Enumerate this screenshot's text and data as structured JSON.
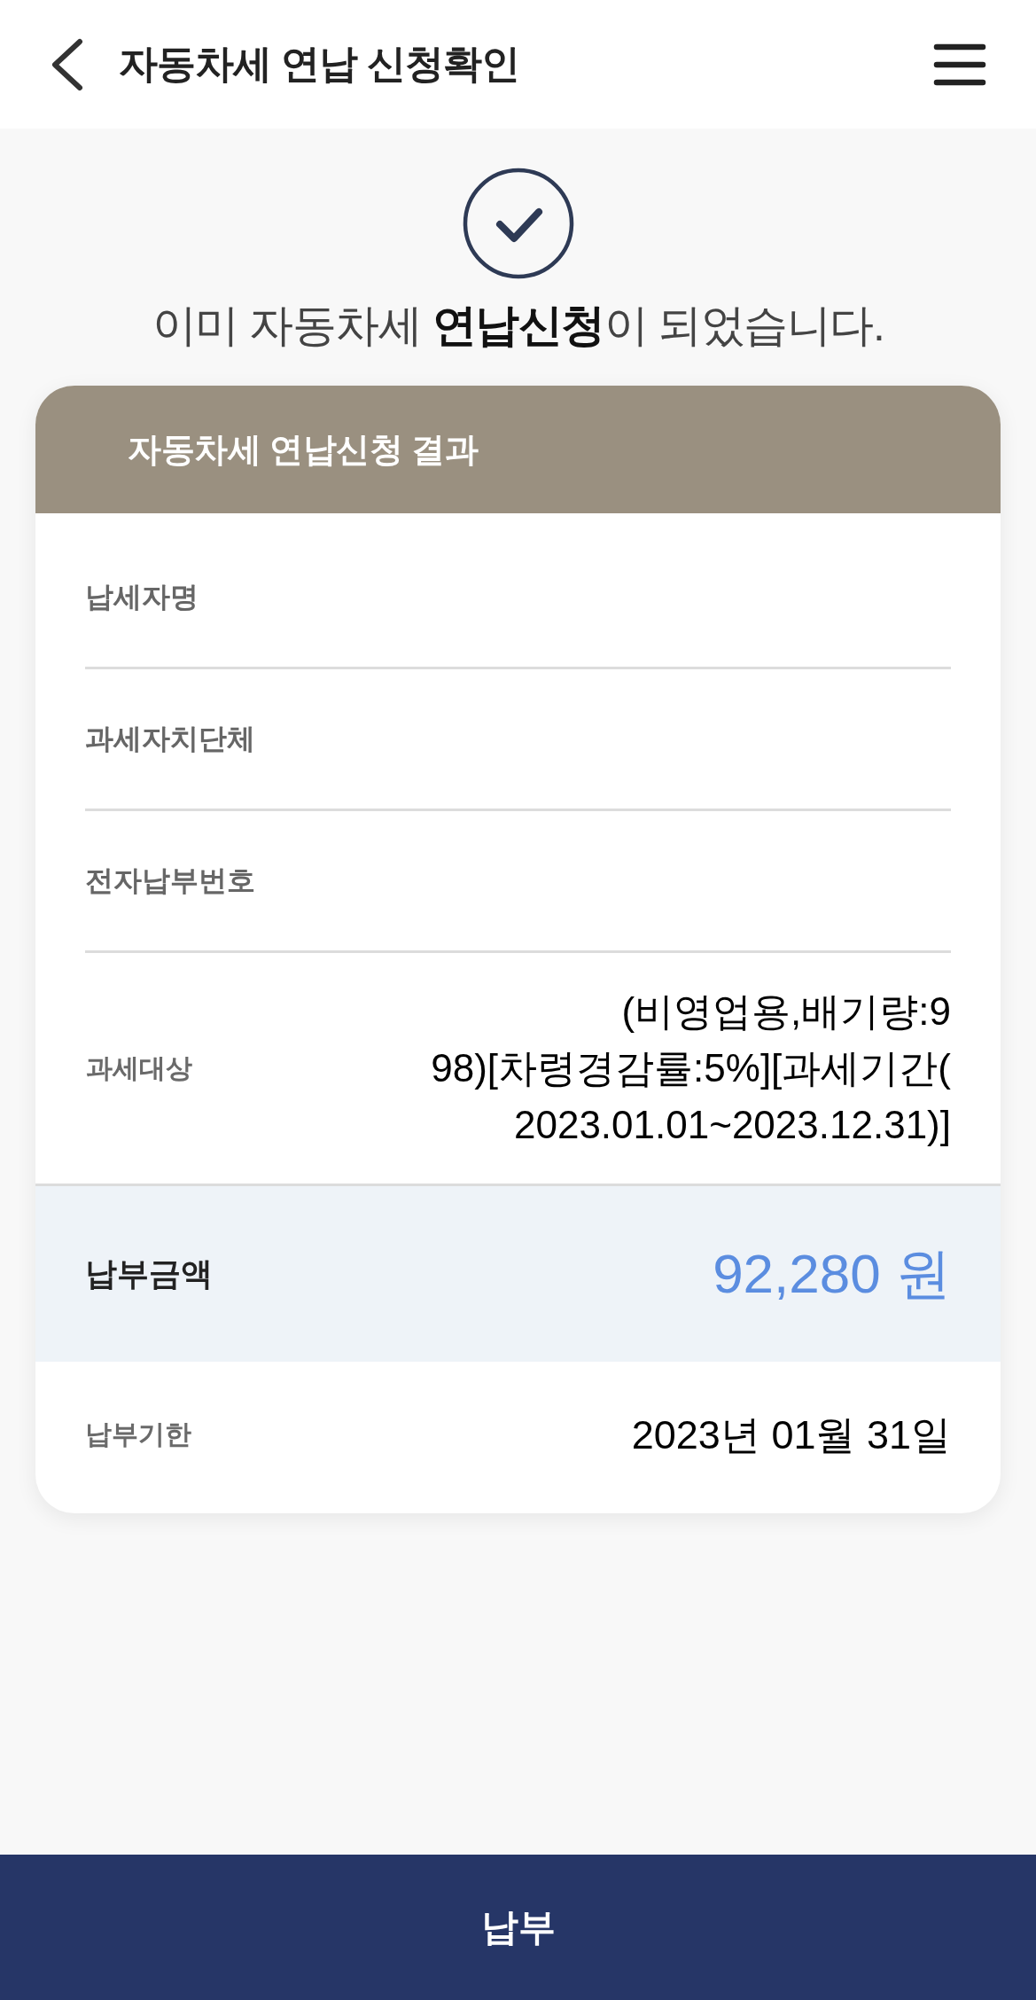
{
  "header": {
    "title": "자동차세 연납 신청확인"
  },
  "notice": {
    "message": "이미 자동차세 **연납신청**이 되었습니다."
  },
  "result_card": {
    "title": "자동차세 연납신청 결과",
    "rows": [
      {
        "kind": "field",
        "label": "납세자명"
      },
      {
        "kind": "field",
        "label": "과세자치단체"
      },
      {
        "kind": "field",
        "label": "전자납부번호"
      },
      {
        "kind": "detail",
        "label": "과세대상",
        "value_lines": [
          "(비영업용,배기량:9",
          "98)[차령경감률:5%][과세기간(",
          "2023.01.01~2023.12.31)]"
        ]
      },
      {
        "kind": "amount",
        "label": "납부금액",
        "value": "92,280 원"
      },
      {
        "kind": "date",
        "label": "납부기한",
        "value": "2023년 01월 31일"
      }
    ]
  },
  "pay_button": {
    "label": "납부"
  }
}
